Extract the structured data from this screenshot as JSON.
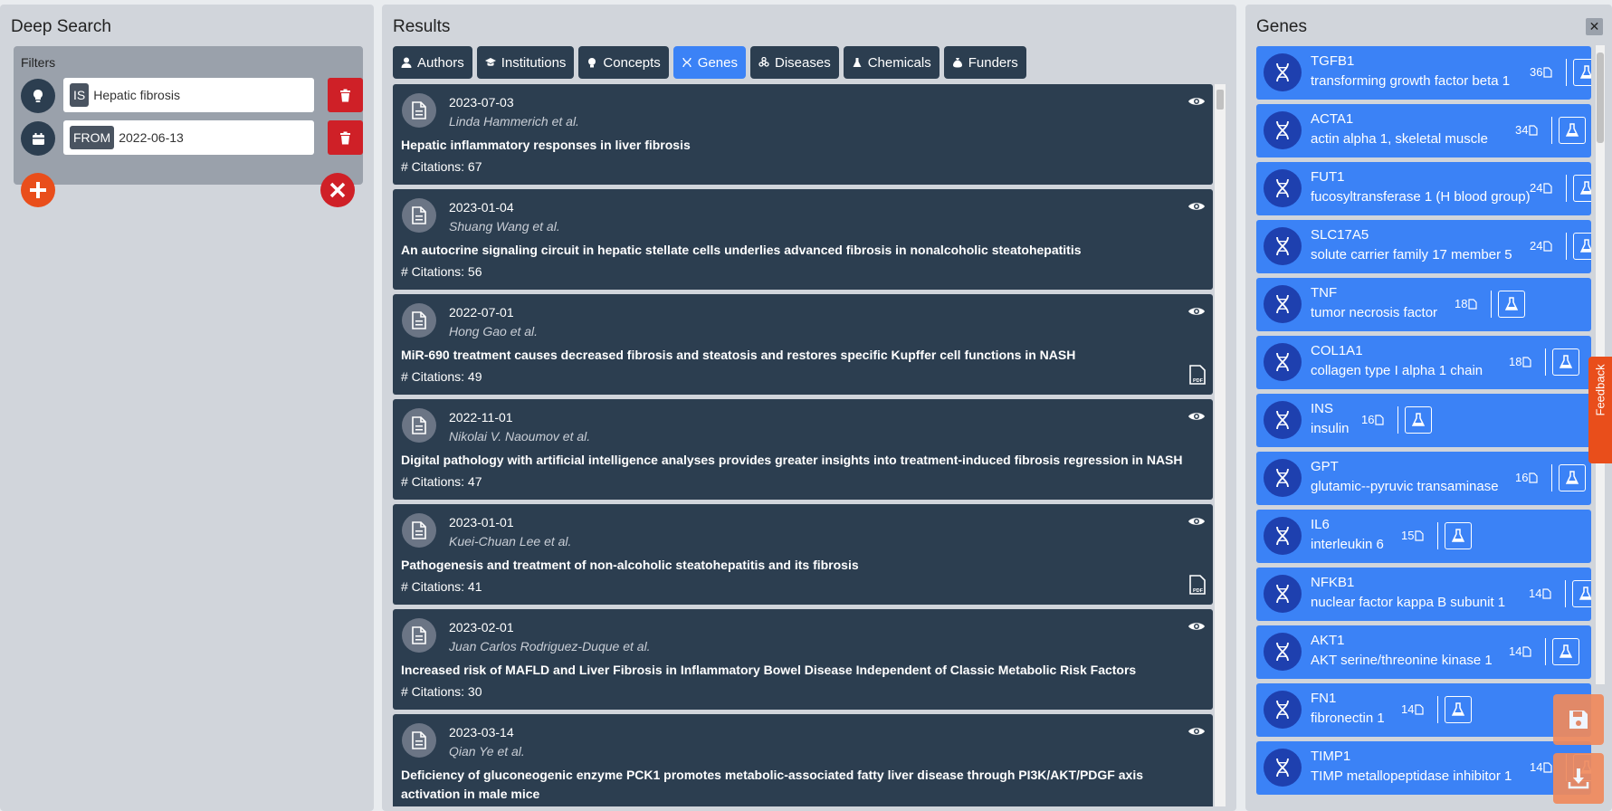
{
  "left": {
    "title": "Deep Search",
    "filters_label": "Filters",
    "filters": [
      {
        "icon": "lightbulb-icon",
        "tag": "IS",
        "value": "Hepatic fibrosis"
      },
      {
        "icon": "calendar-icon",
        "tag": "FROM",
        "value": "2022-06-13"
      }
    ]
  },
  "middle": {
    "title": "Results",
    "tabs": [
      {
        "label": "Authors",
        "icon": "user-icon",
        "active": false
      },
      {
        "label": "Institutions",
        "icon": "graduation-cap-icon",
        "active": false
      },
      {
        "label": "Concepts",
        "icon": "lightbulb-icon",
        "active": false
      },
      {
        "label": "Genes",
        "icon": "dna-icon",
        "active": true
      },
      {
        "label": "Diseases",
        "icon": "biohazard-icon",
        "active": false
      },
      {
        "label": "Chemicals",
        "icon": "flask-icon",
        "active": false
      },
      {
        "label": "Funders",
        "icon": "money-bag-icon",
        "active": false
      }
    ],
    "results": [
      {
        "date": "2023-07-03",
        "authors": "Linda Hammerich et al.",
        "title": "Hepatic inflammatory responses in liver fibrosis",
        "citations": "# Citations: 67",
        "pdf": false
      },
      {
        "date": "2023-01-04",
        "authors": "Shuang Wang et al.",
        "title": "An autocrine signaling circuit in hepatic stellate cells underlies advanced fibrosis in nonalcoholic steatohepatitis",
        "citations": "# Citations: 56",
        "pdf": false
      },
      {
        "date": "2022-07-01",
        "authors": "Hong Gao et al.",
        "title": "MiR-690 treatment causes decreased fibrosis and steatosis and restores specific Kupffer cell functions in NASH",
        "citations": "# Citations: 49",
        "pdf": true
      },
      {
        "date": "2022-11-01",
        "authors": "Nikolai V. Naoumov et al.",
        "title": "Digital pathology with artificial intelligence analyses provides greater insights into treatment-induced fibrosis regression in NASH",
        "citations": "# Citations: 47",
        "pdf": false
      },
      {
        "date": "2023-01-01",
        "authors": "Kuei-Chuan Lee et al.",
        "title": "Pathogenesis and treatment of non-alcoholic steatohepatitis and its fibrosis",
        "citations": "# Citations: 41",
        "pdf": true
      },
      {
        "date": "2023-02-01",
        "authors": "Juan Carlos Rodriguez-Duque et al.",
        "title": "Increased risk of MAFLD and Liver Fibrosis in Inflammatory Bowel Disease Independent of Classic Metabolic Risk Factors",
        "citations": "# Citations: 30",
        "pdf": false
      },
      {
        "date": "2023-03-14",
        "authors": "Qian Ye et al.",
        "title": "Deficiency of gluconeogenic enzyme PCK1 promotes metabolic-associated fatty liver disease through PI3K/AKT/PDGF axis activation in male mice",
        "citations": "",
        "pdf": false
      }
    ]
  },
  "right": {
    "title": "Genes",
    "close_label": "✕",
    "genes": [
      {
        "symbol": "TGFB1",
        "name": "transforming growth factor beta 1",
        "count": "36"
      },
      {
        "symbol": "ACTA1",
        "name": "actin alpha 1, skeletal muscle",
        "count": "34"
      },
      {
        "symbol": "FUT1",
        "name": "fucosyltransferase 1 (H blood group)",
        "count": "24"
      },
      {
        "symbol": "SLC17A5",
        "name": "solute carrier family 17 member 5",
        "count": "24"
      },
      {
        "symbol": "TNF",
        "name": "tumor necrosis factor",
        "count": "18"
      },
      {
        "symbol": "COL1A1",
        "name": "collagen type I alpha 1 chain",
        "count": "18"
      },
      {
        "symbol": "INS",
        "name": "insulin",
        "count": "16"
      },
      {
        "symbol": "GPT",
        "name": "glutamic--pyruvic transaminase",
        "count": "16"
      },
      {
        "symbol": "IL6",
        "name": "interleukin 6",
        "count": "15"
      },
      {
        "symbol": "NFKB1",
        "name": "nuclear factor kappa B subunit 1",
        "count": "14"
      },
      {
        "symbol": "AKT1",
        "name": "AKT serine/threonine kinase 1",
        "count": "14"
      },
      {
        "symbol": "FN1",
        "name": "fibronectin 1",
        "count": "14"
      },
      {
        "symbol": "TIMP1",
        "name": "TIMP metallopeptidase inhibitor 1",
        "count": "14"
      }
    ]
  },
  "feedback_label": "Feedback",
  "colors": {
    "dark": "#2c3e50",
    "accent": "#3b82f6",
    "danger": "#cf2027",
    "orange": "#e94e1b"
  }
}
